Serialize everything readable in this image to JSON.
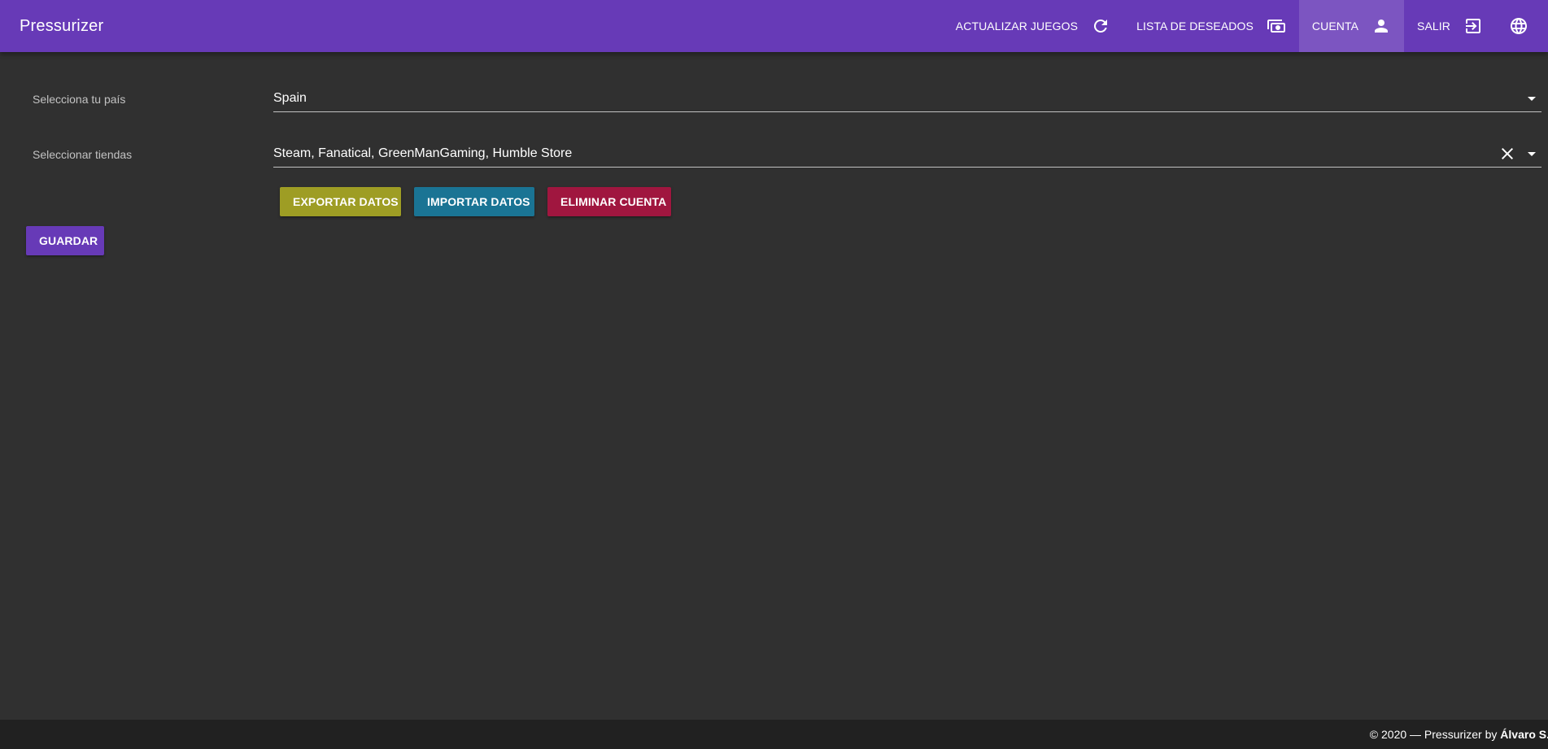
{
  "app": {
    "title": "Pressurizer",
    "brand_color": "#673ab7",
    "background_color": "#303030"
  },
  "nav": {
    "items": [
      {
        "label": "ACTUALIZAR JUEGOS",
        "icon": "refresh-icon",
        "active": false
      },
      {
        "label": "LISTA DE DESEADOS",
        "icon": "money-icon",
        "active": false
      },
      {
        "label": "CUENTA",
        "icon": "account-icon",
        "active": true
      },
      {
        "label": "SALIR",
        "icon": "logout-icon",
        "active": false
      },
      {
        "label": "",
        "icon": "globe-icon",
        "active": false
      }
    ]
  },
  "form": {
    "country": {
      "label": "Selecciona tu país",
      "value": "Spain"
    },
    "stores": {
      "label": "Seleccionar tiendas",
      "value": "Steam, Fanatical, GreenManGaming, Humble Store"
    }
  },
  "buttons": {
    "export": {
      "label": "EXPORTAR DATOS",
      "color": "#9e9d24"
    },
    "import": {
      "label": "IMPORTAR DATOS",
      "color": "#1a7494"
    },
    "delete": {
      "label": "ELIMINAR CUENTA",
      "color": "#a0163f"
    },
    "save": {
      "label": "GUARDAR",
      "color": "#673ab7"
    }
  },
  "footer": {
    "prefix": "© 2020 — Pressurizer by ",
    "author": "Álvaro S."
  }
}
